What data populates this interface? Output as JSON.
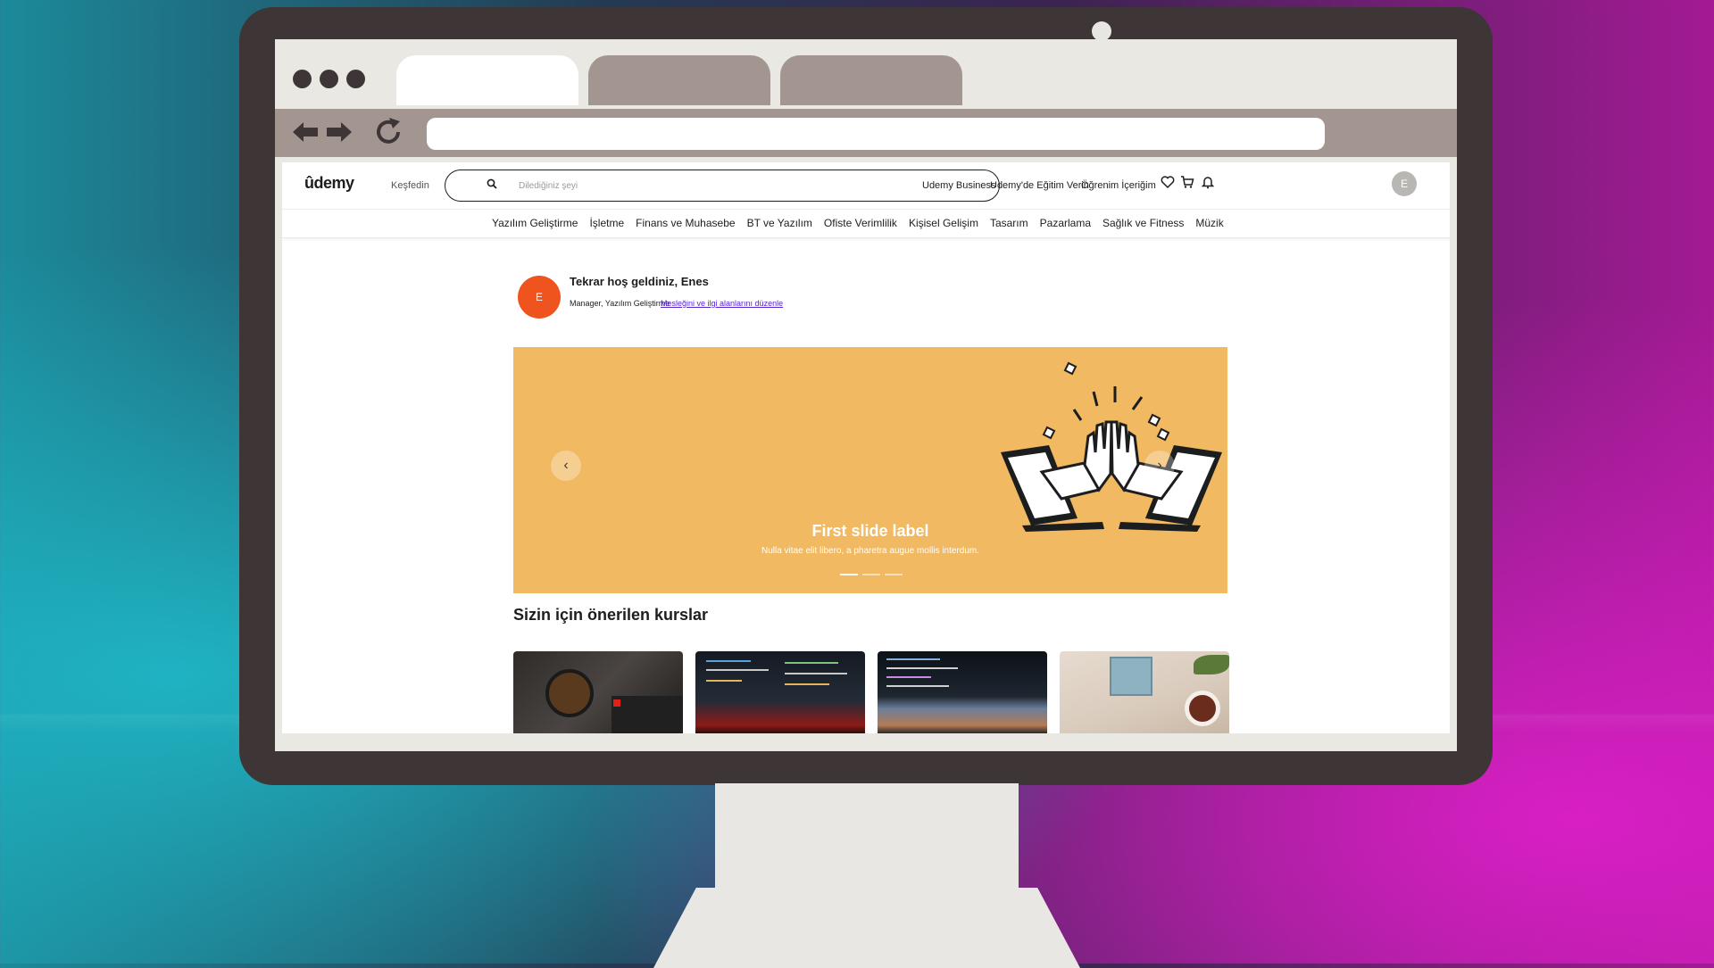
{
  "browser": {
    "address": ""
  },
  "header": {
    "logo": "ûdemy",
    "explore": "Keşfedin",
    "search_placeholder": "Dilediğiniz şeyi",
    "links": [
      "Udemy Business",
      "Udemy'de Eğitim Verin",
      "Öğrenim İçeriğim"
    ],
    "avatar_initial": "E"
  },
  "categories": [
    "Yazılım Geliştirme",
    "İşletme",
    "Finans ve Muhasebe",
    "BT ve Yazılım",
    "Ofiste Verimlilik",
    "Kişisel Gelişim",
    "Tasarım",
    "Pazarlama",
    "Sağlık ve Fitness",
    "Müzik"
  ],
  "welcome": {
    "avatar_initial": "E",
    "title": "Tekrar hoş geldiniz, Enes",
    "subtitle": "Manager, Yazılım Geliştirme",
    "edit_link": "Mesleğini ve ilgi alanlarını düzenle"
  },
  "carousel": {
    "title": "First slide label",
    "text": "Nulla vitae elit libero, a pharetra augue mollis interdum.",
    "background": "#f1b962",
    "slide_count": 3,
    "active_slide": 1
  },
  "recommended": {
    "title": "Sizin için önerilen kurslar"
  },
  "colors": {
    "accent_orange": "#f0541e",
    "link_purple": "#5624d0",
    "browser_gray": "#a39690",
    "monitor": "#3d3536"
  }
}
